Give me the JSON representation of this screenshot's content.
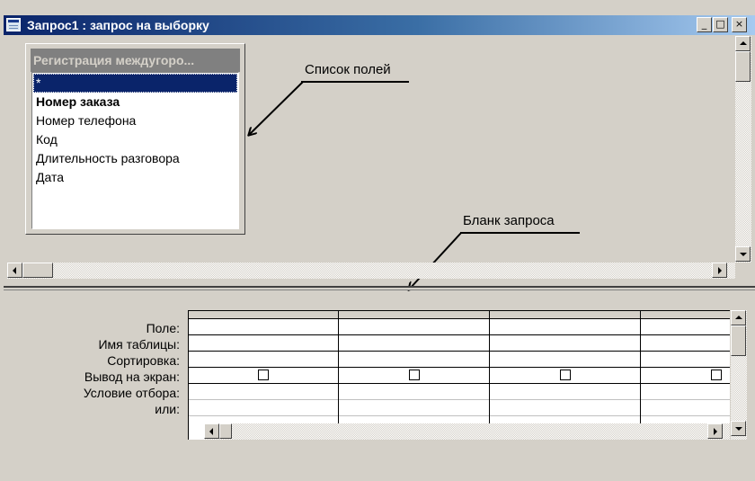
{
  "window": {
    "title": "Запрос1 : запрос на выборку",
    "controls": {
      "minimize": "_",
      "maximize": "□",
      "close": "×"
    }
  },
  "upper_pane": {
    "table_box": {
      "title": "Регистрация междугоро...",
      "fields": [
        {
          "label": "*",
          "selected": true,
          "bold": false
        },
        {
          "label": "Номер заказа",
          "selected": false,
          "bold": true
        },
        {
          "label": "Номер телефона",
          "selected": false,
          "bold": false
        },
        {
          "label": "Код",
          "selected": false,
          "bold": false
        },
        {
          "label": "Длительность разговора",
          "selected": false,
          "bold": false
        },
        {
          "label": "Дата",
          "selected": false,
          "bold": false
        }
      ]
    },
    "annotations": {
      "field_list": "Список полей",
      "query_form": "Бланк запроса"
    }
  },
  "grid": {
    "row_labels": [
      "Поле:",
      "Имя таблицы:",
      "Сортировка:",
      "Вывод на экран:",
      "Условие отбора:",
      "или:"
    ],
    "columns_visible": 4,
    "show_checkboxes": [
      false,
      false,
      false,
      false
    ]
  },
  "icons": {
    "window_icon": "query-window-icon",
    "scroll_up": "arrow-up-icon",
    "scroll_down": "arrow-down-icon",
    "scroll_left": "arrow-left-icon",
    "scroll_right": "arrow-right-icon"
  },
  "colors": {
    "title_gradient_start": "#0a246a",
    "title_gradient_end": "#a6caf0",
    "selection": "#0a246a",
    "face": "#d4d0c8"
  }
}
